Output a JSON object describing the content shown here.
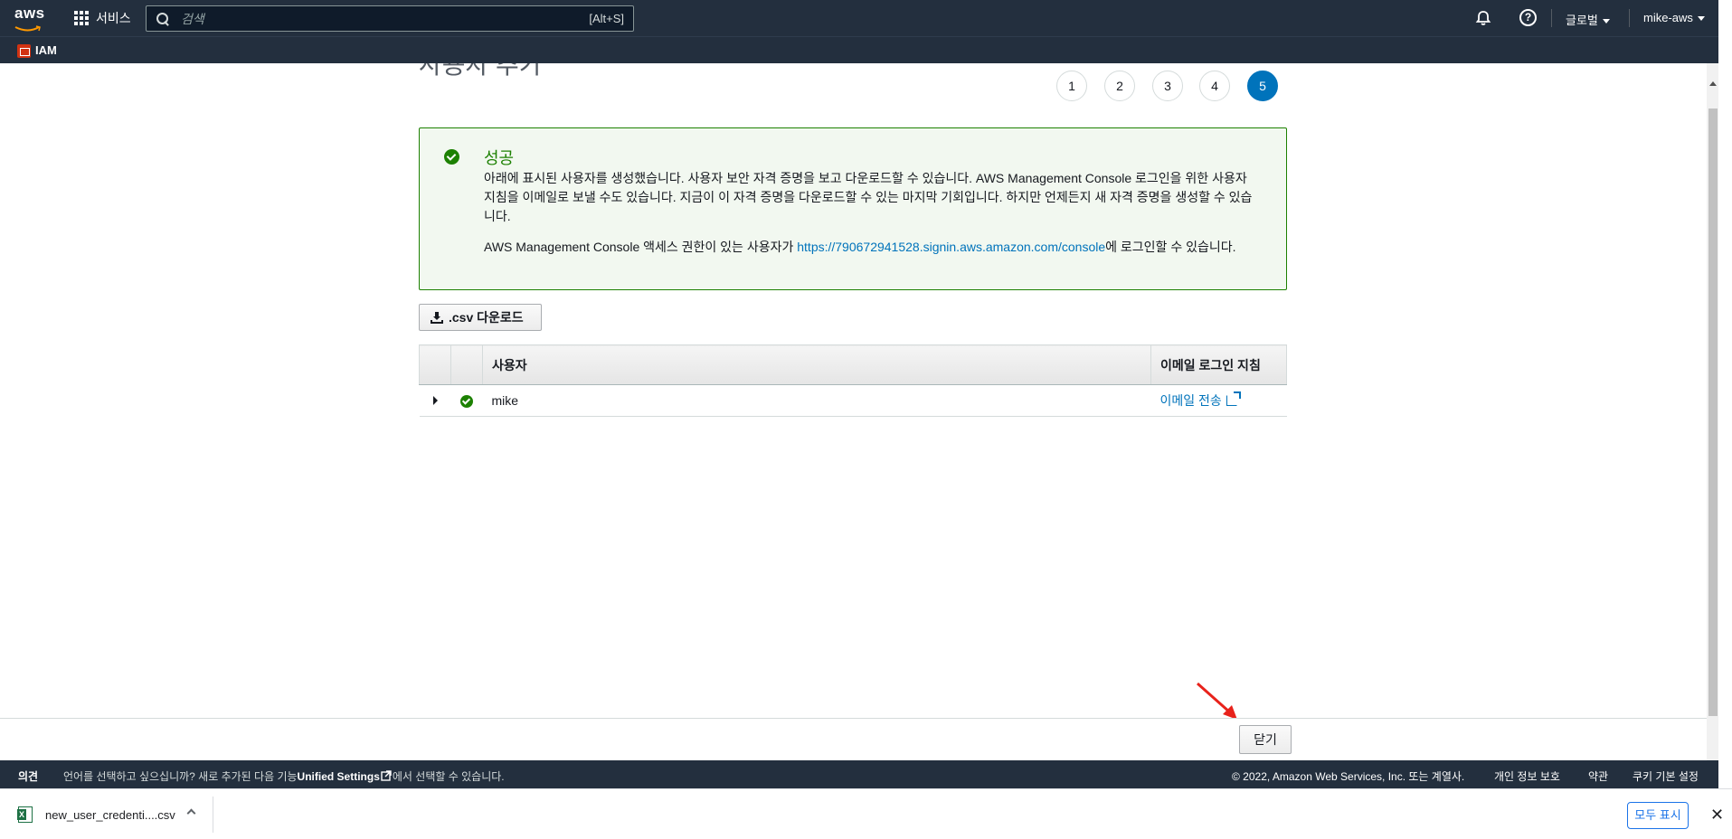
{
  "topnav": {
    "logo_text": "aws",
    "services_label": "서비스",
    "search_placeholder": "검색",
    "search_shortcut": "[Alt+S]",
    "region_label": "글로벌",
    "user_label": "mike-aws"
  },
  "subnav": {
    "service_label": "IAM"
  },
  "page": {
    "title": "사용자 추가",
    "steps": [
      "1",
      "2",
      "3",
      "4",
      "5"
    ],
    "active_step": "5"
  },
  "alert": {
    "title": "성공",
    "body": "아래에 표시된 사용자를 생성했습니다. 사용자 보안 자격 증명을 보고 다운로드할 수 있습니다. AWS Management Console 로그인을 위한 사용자 지침을 이메일로 보낼 수도 있습니다. 지금이 이 자격 증명을 다운로드할 수 있는 마지막 기회입니다. 하지만 언제든지 새 자격 증명을 생성할 수 있습니다.",
    "line2_prefix": "AWS Management Console 액세스 권한이 있는 사용자가 ",
    "line2_link": "https://790672941528.signin.aws.amazon.com/console",
    "line2_suffix": "에 로그인할 수 있습니다."
  },
  "csv_button": ".csv 다운로드",
  "table": {
    "headers": {
      "user": "사용자",
      "email": "이메일 로그인 지침"
    },
    "rows": [
      {
        "user": "mike",
        "email_action": "이메일 전송"
      }
    ]
  },
  "action_bar": {
    "close_label": "닫기"
  },
  "footer": {
    "feedback": "의견",
    "msg_prefix": "언어를 선택하고 싶으십니까? 새로 추가된 다음 기능",
    "msg_link": "Unified Settings",
    "msg_suffix": "에서 선택할 수 있습니다.",
    "copyright": "© 2022, Amazon Web Services, Inc. 또는 계열사.",
    "privacy": "개인 정보 보호",
    "terms": "약관",
    "cookies": "쿠키 기본 설정"
  },
  "download_shelf": {
    "filename": "new_user_credenti....csv",
    "show_all": "모두 표시",
    "close_symbol": "✕"
  },
  "colors": {
    "nav_bg": "#232f3e",
    "success": "#1d8102",
    "link": "#0073bb",
    "annotation_arrow": "#e8221b"
  }
}
